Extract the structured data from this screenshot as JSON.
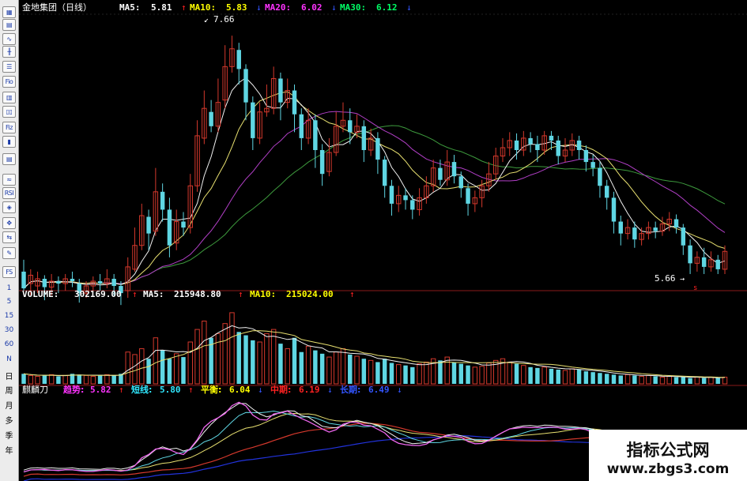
{
  "colors": {
    "up": "#d4382c",
    "down": "#5fd6e3",
    "ma_white": "#f2f2f2",
    "ma_yellow": "#e8e070",
    "ma_purple": "#b13fc6",
    "ma_green": "#3d9a3d",
    "pink": "#ee66ee",
    "label_white": "#ffffff",
    "label_yellow": "#ffff00",
    "label_magenta": "#ff33ff",
    "label_green": "#00ff66",
    "label_cyan": "#30e8ff",
    "label_red": "#ff2222",
    "label_blue": "#3355ff",
    "grid_red": "#8a1a1a"
  },
  "toolbar": {
    "icons": [
      "table-icon",
      "grid-icon",
      "line-chart-icon",
      "candlestick-icon",
      "list-icon",
      "fio-icon",
      "notes-icon",
      "columns-icon",
      "fiz-icon",
      "kline-icon",
      "document-icon",
      "wave-icon",
      "rsi-icon",
      "stock-bag-icon",
      "move-icon",
      "transfer-icon",
      "pencil-icon",
      "fs-icon"
    ],
    "labels": {
      "fio": "Fio",
      "fiz": "Fiz",
      "rsi": "RSI",
      "fs": "FS"
    },
    "periods": [
      "1",
      "5",
      "15",
      "30",
      "60",
      "N",
      "日",
      "周",
      "月",
      "多",
      "季",
      "年"
    ]
  },
  "price_panel": {
    "stock_name": "金地集团（日线）",
    "ma5_label": "MA5:",
    "ma5_value": "5.81",
    "ma10_label": "MA10:",
    "ma10_value": "5.83",
    "ma20_label": "MA20:",
    "ma20_value": "6.02",
    "ma30_label": "MA30:",
    "ma30_value": "6.12",
    "high_marker": "7.66",
    "low_marker": "5.66"
  },
  "volume_panel": {
    "volume_label": "VOLUME:",
    "volume_value": "302169.00",
    "ma5_label": "MA5:",
    "ma5_value": "215948.80",
    "ma10_label": "MA10:",
    "ma10_value": "215024.00"
  },
  "indicator_panel": {
    "name": "麒麟刀",
    "trend_label": "趋势:",
    "trend_value": "5.82",
    "short_label": "短线:",
    "short_value": "5.80",
    "balance_label": "平衡:",
    "balance_value": "6.04",
    "mid_label": "中期:",
    "mid_value": "6.19",
    "long_label": "长期:",
    "long_value": "6.49"
  },
  "chart_data": {
    "type": "candlestick",
    "price_ylim": [
      5.6,
      7.8
    ],
    "candles": [
      [
        5.68,
        5.54,
        5.78,
        5.52
      ],
      [
        5.58,
        5.65,
        5.7,
        5.48
      ],
      [
        5.56,
        5.62,
        5.68,
        5.5
      ],
      [
        5.62,
        5.55,
        5.65,
        5.44
      ],
      [
        5.55,
        5.6,
        5.66,
        5.48
      ],
      [
        5.6,
        5.58,
        5.64,
        5.5
      ],
      [
        5.58,
        5.62,
        5.66,
        5.52
      ],
      [
        5.62,
        5.6,
        5.68,
        5.55
      ],
      [
        5.58,
        5.5,
        5.62,
        5.42
      ],
      [
        5.5,
        5.56,
        5.6,
        5.46
      ],
      [
        5.56,
        5.6,
        5.64,
        5.52
      ],
      [
        5.6,
        5.58,
        5.66,
        5.52
      ],
      [
        5.58,
        5.62,
        5.7,
        5.54
      ],
      [
        5.62,
        5.56,
        5.66,
        5.48
      ],
      [
        5.56,
        5.5,
        5.6,
        5.4
      ],
      [
        5.52,
        5.72,
        5.8,
        5.46
      ],
      [
        5.7,
        5.9,
        6.05,
        5.68
      ],
      [
        5.9,
        6.15,
        6.25,
        5.86
      ],
      [
        6.14,
        6.0,
        6.2,
        5.86
      ],
      [
        6.02,
        6.35,
        6.55,
        5.98
      ],
      [
        6.35,
        6.2,
        6.42,
        6.1
      ],
      [
        6.2,
        5.9,
        6.3,
        5.8
      ],
      [
        5.92,
        6.1,
        6.2,
        5.86
      ],
      [
        6.1,
        6.05,
        6.18,
        5.98
      ],
      [
        6.05,
        6.4,
        6.5,
        6.0
      ],
      [
        6.4,
        6.82,
        6.95,
        6.35
      ],
      [
        6.8,
        7.05,
        7.2,
        6.75
      ],
      [
        7.02,
        6.9,
        7.12,
        6.85
      ],
      [
        6.9,
        7.1,
        7.3,
        6.85
      ],
      [
        7.12,
        7.4,
        7.58,
        7.05
      ],
      [
        7.4,
        7.55,
        7.66,
        7.35
      ],
      [
        7.54,
        7.38,
        7.6,
        7.25
      ],
      [
        7.38,
        7.1,
        7.42,
        6.95
      ],
      [
        7.1,
        6.8,
        7.15,
        6.7
      ],
      [
        6.8,
        7.02,
        7.1,
        6.75
      ],
      [
        7.02,
        7.05,
        7.25,
        6.98
      ],
      [
        7.05,
        7.3,
        7.4,
        7.0
      ],
      [
        7.3,
        7.1,
        7.35,
        6.95
      ],
      [
        7.1,
        7.2,
        7.3,
        7.05
      ],
      [
        7.2,
        7.0,
        7.25,
        6.85
      ],
      [
        7.0,
        6.8,
        7.05,
        6.7
      ],
      [
        6.8,
        6.95,
        7.05,
        6.75
      ],
      [
        6.95,
        6.7,
        7.0,
        6.55
      ],
      [
        6.7,
        6.5,
        6.75,
        6.4
      ],
      [
        6.52,
        6.68,
        6.8,
        6.48
      ],
      [
        6.68,
        6.9,
        7.02,
        6.65
      ],
      [
        6.9,
        6.95,
        7.1,
        6.85
      ],
      [
        6.95,
        6.85,
        7.05,
        6.75
      ],
      [
        6.85,
        6.9,
        7.0,
        6.8
      ],
      [
        6.9,
        6.7,
        6.95,
        6.6
      ],
      [
        6.7,
        6.8,
        6.88,
        6.65
      ],
      [
        6.8,
        6.62,
        6.85,
        6.5
      ],
      [
        6.62,
        6.4,
        6.65,
        6.3
      ],
      [
        6.4,
        6.25,
        6.45,
        6.15
      ],
      [
        6.25,
        6.32,
        6.4,
        6.18
      ],
      [
        6.32,
        6.28,
        6.38,
        6.2
      ],
      [
        6.28,
        6.2,
        6.32,
        6.12
      ],
      [
        6.2,
        6.3,
        6.38,
        6.15
      ],
      [
        6.3,
        6.4,
        6.48,
        6.25
      ],
      [
        6.4,
        6.55,
        6.62,
        6.35
      ],
      [
        6.55,
        6.45,
        6.62,
        6.4
      ],
      [
        6.45,
        6.6,
        6.7,
        6.4
      ],
      [
        6.6,
        6.48,
        6.66,
        6.42
      ],
      [
        6.48,
        6.38,
        6.52,
        6.3
      ],
      [
        6.38,
        6.25,
        6.42,
        6.15
      ],
      [
        6.25,
        6.3,
        6.36,
        6.18
      ],
      [
        6.3,
        6.4,
        6.45,
        6.22
      ],
      [
        6.4,
        6.5,
        6.6,
        6.35
      ],
      [
        6.5,
        6.65,
        6.72,
        6.45
      ],
      [
        6.65,
        6.72,
        6.8,
        6.6
      ],
      [
        6.72,
        6.78,
        6.85,
        6.65
      ],
      [
        6.78,
        6.7,
        6.84,
        6.62
      ],
      [
        6.7,
        6.8,
        6.86,
        6.65
      ],
      [
        6.8,
        6.75,
        6.85,
        6.68
      ],
      [
        6.75,
        6.7,
        6.82,
        6.6
      ],
      [
        6.7,
        6.82,
        6.86,
        6.66
      ],
      [
        6.82,
        6.78,
        6.86,
        6.7
      ],
      [
        6.78,
        6.65,
        6.82,
        6.58
      ],
      [
        6.65,
        6.7,
        6.8,
        6.6
      ],
      [
        6.7,
        6.78,
        6.84,
        6.65
      ],
      [
        6.78,
        6.7,
        6.82,
        6.62
      ],
      [
        6.7,
        6.6,
        6.74,
        6.52
      ],
      [
        6.6,
        6.55,
        6.66,
        6.48
      ],
      [
        6.55,
        6.4,
        6.6,
        6.3
      ],
      [
        6.4,
        6.3,
        6.45,
        6.2
      ],
      [
        6.3,
        6.1,
        6.35,
        6.0
      ],
      [
        6.1,
        6.0,
        6.15,
        5.9
      ],
      [
        6.0,
        6.05,
        6.12,
        5.95
      ],
      [
        6.05,
        5.95,
        6.1,
        5.88
      ],
      [
        5.95,
        6.0,
        6.05,
        5.9
      ],
      [
        6.0,
        6.05,
        6.1,
        5.95
      ],
      [
        6.05,
        6.02,
        6.1,
        5.96
      ],
      [
        6.02,
        6.08,
        6.14,
        5.98
      ],
      [
        6.08,
        6.12,
        6.18,
        6.02
      ],
      [
        6.12,
        6.05,
        6.16,
        6.0
      ],
      [
        6.05,
        5.9,
        6.08,
        5.82
      ],
      [
        5.9,
        5.75,
        5.95,
        5.66
      ],
      [
        5.75,
        5.8,
        5.85,
        5.68
      ],
      [
        5.8,
        5.72,
        5.88,
        5.66
      ],
      [
        5.72,
        5.78,
        5.85,
        5.68
      ],
      [
        5.78,
        5.7,
        5.82,
        5.66
      ],
      [
        5.7,
        5.85,
        5.9,
        5.66
      ]
    ],
    "volume_rel": [
      0.12,
      0.1,
      0.09,
      0.1,
      0.11,
      0.09,
      0.1,
      0.12,
      0.11,
      0.1,
      0.09,
      0.1,
      0.11,
      0.1,
      0.12,
      0.38,
      0.35,
      0.42,
      0.3,
      0.55,
      0.4,
      0.3,
      0.36,
      0.32,
      0.5,
      0.65,
      0.75,
      0.55,
      0.6,
      0.72,
      0.85,
      0.62,
      0.58,
      0.52,
      0.5,
      0.6,
      0.65,
      0.48,
      0.42,
      0.55,
      0.38,
      0.45,
      0.4,
      0.36,
      0.32,
      0.38,
      0.42,
      0.35,
      0.33,
      0.3,
      0.28,
      0.26,
      0.3,
      0.25,
      0.23,
      0.22,
      0.2,
      0.24,
      0.26,
      0.3,
      0.28,
      0.32,
      0.26,
      0.24,
      0.22,
      0.2,
      0.21,
      0.25,
      0.28,
      0.3,
      0.26,
      0.24,
      0.22,
      0.2,
      0.19,
      0.2,
      0.18,
      0.17,
      0.16,
      0.18,
      0.17,
      0.15,
      0.14,
      0.13,
      0.12,
      0.11,
      0.1,
      0.11,
      0.1,
      0.09,
      0.1,
      0.09,
      0.08,
      0.09,
      0.08,
      0.08,
      0.07,
      0.08,
      0.07,
      0.08,
      0.07,
      0.08
    ]
  },
  "watermark": {
    "title": "指标公式网",
    "url": "www.zbgs3.com"
  }
}
